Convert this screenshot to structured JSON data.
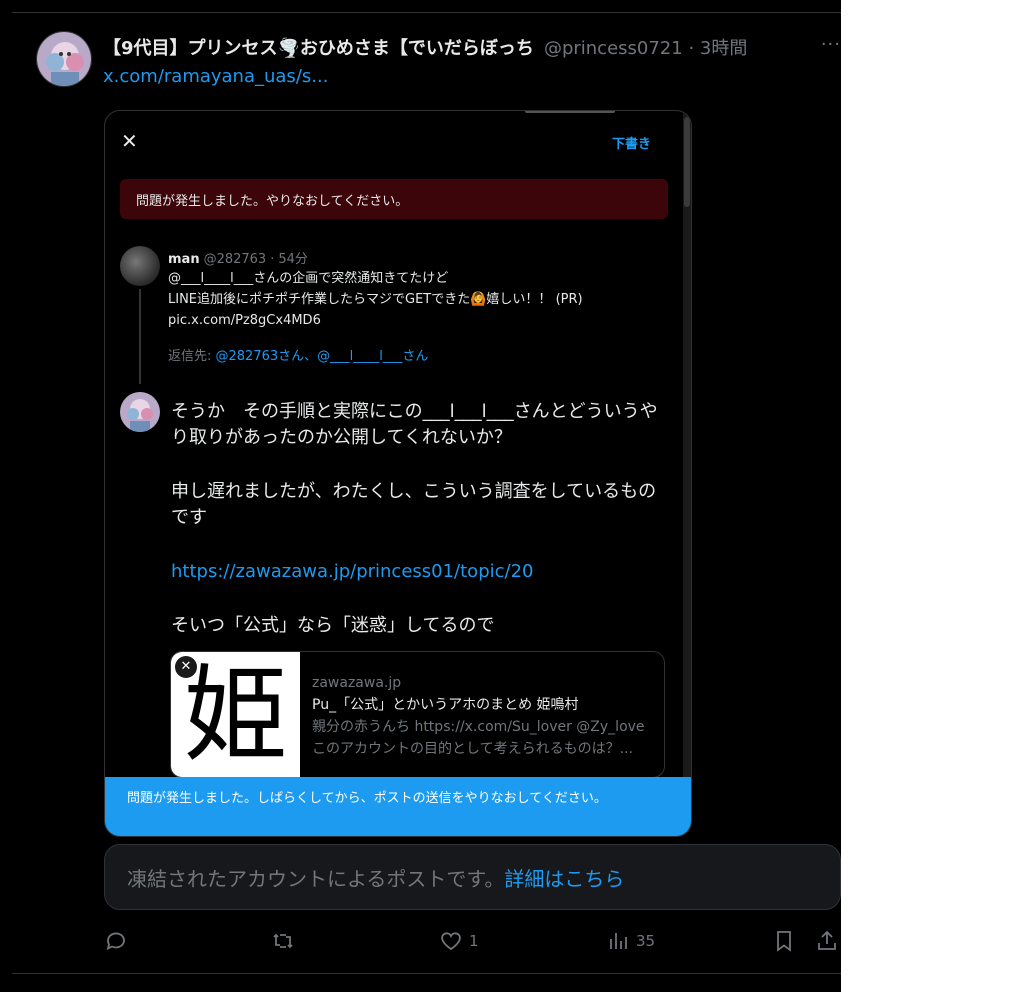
{
  "post": {
    "author_name": "【9代目】プリンセス🌪️おひめさま【でいだらぼっち",
    "handle": "@princess0721",
    "time": "3時間",
    "more": "···",
    "link": "x.com/ramayana_uas/s..."
  },
  "embed": {
    "close": "✕",
    "drafts": "下書き",
    "error_top": "問題が発生しました。やりなおしてください。",
    "quoted": {
      "name": "man",
      "handle": "@282763",
      "time": "54分",
      "line1": "@___l____l___さんの企画で突然通知きてたけど",
      "line2": "LINE追加後にポチポチ作業したらマジでGETできた🙆嬉しい！！ (PR)",
      "line3": "pic.x.com/Pz8gCx4MD6",
      "reply_prefix": "返信先: ",
      "reply_to": "@282763さん、@___l____l___さん"
    },
    "message": {
      "p1": "そうか　その手順と実際にこの___l___l___さんとどういうやり取りがあったのか公開してくれないか？",
      "p2": "申し遅れましたが、わたくし、こういう調査をしているものです",
      "p3": "https://zawazawa.jp/princess01/topic/20",
      "p4": "そいつ「公式」なら「迷惑」してるので"
    },
    "card": {
      "thumb_char": "姫",
      "remove": "✕",
      "domain": "zawazawa.jp",
      "title": "Pu_「公式」とかいうアホのまとめ 姫鳴村",
      "desc1": "親分の赤うんち https://x.com/Su_lover @Zy_love",
      "desc2": "このアカウントの目的として考えられるものは？..."
    },
    "error_bottom": "問題が発生しました。しばらくしてから、ポストの送信をやりなおしてください。"
  },
  "suspended": {
    "text": "凍結されたアカウントによるポストです。",
    "learn_more": "詳細はこちら"
  },
  "actions": {
    "likes": "1",
    "views": "35"
  },
  "colors": {
    "accent": "#1d9bf0",
    "error_red": "#3b0509",
    "bg": "#000000"
  }
}
